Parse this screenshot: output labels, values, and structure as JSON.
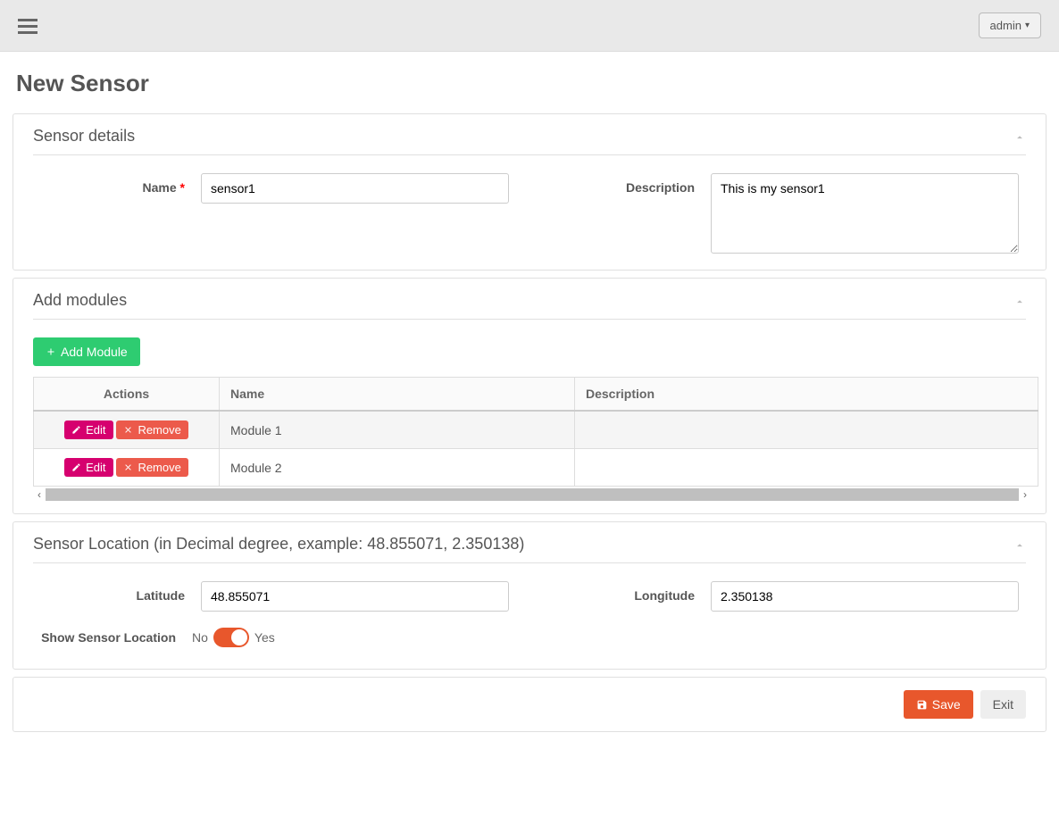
{
  "header": {
    "user_label": "admin"
  },
  "page": {
    "title": "New Sensor"
  },
  "details": {
    "panel_title": "Sensor details",
    "name_label": "Name",
    "name_value": "sensor1",
    "desc_label": "Description",
    "desc_value": "This is my sensor1"
  },
  "modules": {
    "panel_title": "Add modules",
    "add_button": "Add Module",
    "columns": {
      "actions": "Actions",
      "name": "Name",
      "description": "Description"
    },
    "edit_label": "Edit",
    "remove_label": "Remove",
    "rows": [
      {
        "name": "Module 1",
        "description": ""
      },
      {
        "name": "Module 2",
        "description": ""
      }
    ]
  },
  "location": {
    "panel_title": "Sensor Location (in Decimal degree, example: 48.855071, 2.350138)",
    "lat_label": "Latitude",
    "lat_value": "48.855071",
    "lon_label": "Longitude",
    "lon_value": "2.350138",
    "show_label": "Show Sensor Location",
    "no_label": "No",
    "yes_label": "Yes"
  },
  "footer": {
    "save": "Save",
    "exit": "Exit"
  }
}
